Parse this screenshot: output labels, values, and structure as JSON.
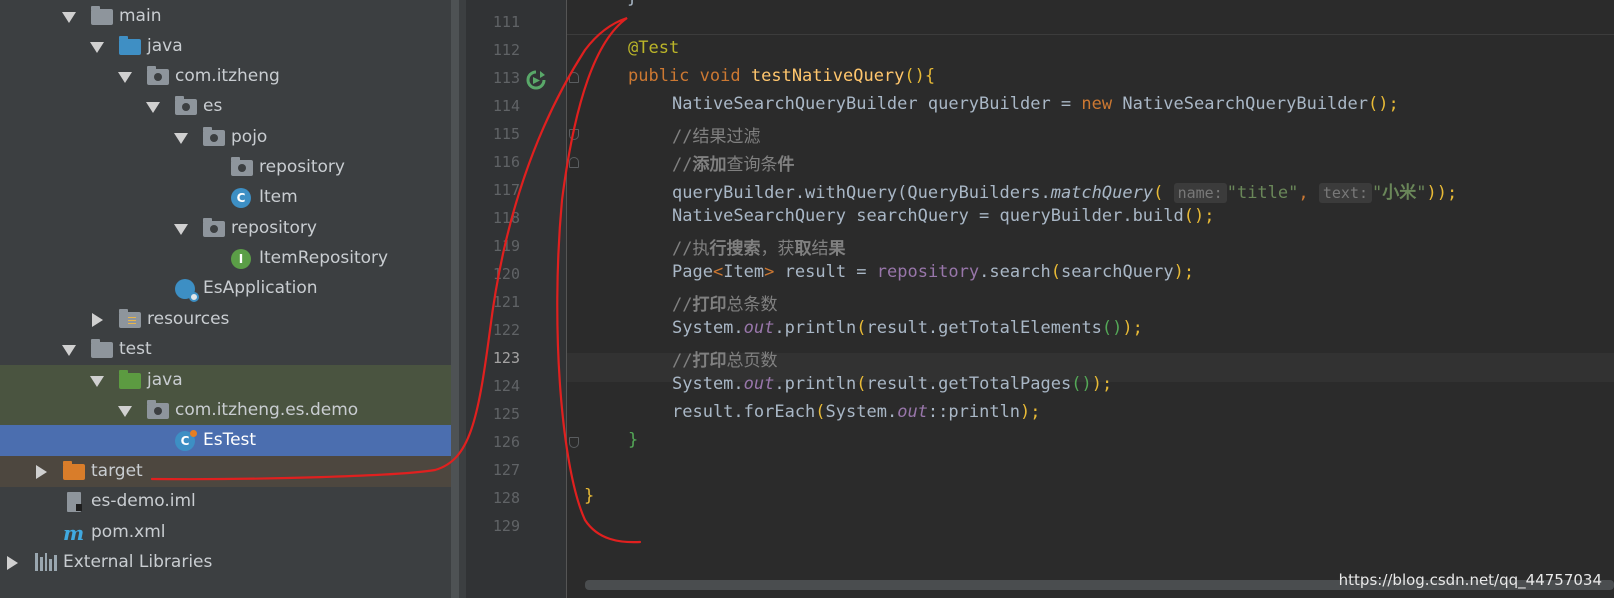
{
  "project_tree": {
    "items": [
      {
        "label": "main",
        "icon": "folder-icon",
        "expanded": true
      },
      {
        "label": "java",
        "icon": "source-folder-icon",
        "expanded": true
      },
      {
        "label": "com.itzheng",
        "icon": "package-icon",
        "expanded": true
      },
      {
        "label": "es",
        "icon": "package-icon",
        "expanded": true
      },
      {
        "label": "pojo",
        "icon": "package-icon",
        "expanded": true
      },
      {
        "label": "repository",
        "icon": "package-icon"
      },
      {
        "label": "Item",
        "icon": "class-icon",
        "icon_letter": "C"
      },
      {
        "label": "repository",
        "icon": "package-icon",
        "expanded": true
      },
      {
        "label": "ItemRepository",
        "icon": "interface-icon",
        "icon_letter": "I"
      },
      {
        "label": "EsApplication",
        "icon": "spring-boot-app-icon"
      },
      {
        "label": "resources",
        "icon": "resources-folder-icon",
        "expanded": false
      },
      {
        "label": "test",
        "icon": "folder-icon",
        "expanded": true
      },
      {
        "label": "java",
        "icon": "test-source-folder-icon",
        "expanded": true
      },
      {
        "label": "com.itzheng.es.demo",
        "icon": "package-icon",
        "expanded": true
      },
      {
        "label": "EsTest",
        "icon": "test-class-icon",
        "icon_letter": "C",
        "selected": true
      },
      {
        "label": "target",
        "icon": "excluded-folder-icon",
        "expanded": false
      },
      {
        "label": "es-demo.iml",
        "icon": "iml-file-icon"
      },
      {
        "label": "pom.xml",
        "icon": "maven-icon",
        "icon_letter": "m"
      },
      {
        "label": "External Libraries",
        "icon": "library-icon",
        "expanded": false
      }
    ]
  },
  "editor": {
    "line_numbers": [
      "111",
      "112",
      "113",
      "114",
      "115",
      "116",
      "117",
      "118",
      "119",
      "120",
      "121",
      "122",
      "123",
      "124",
      "125",
      "126",
      "127",
      "128",
      "129"
    ],
    "current_line": "123",
    "code": {
      "top_brace": "}",
      "annotation": "@Test",
      "l113": {
        "public": "public",
        "void": "void",
        "method": "testNativeQuery",
        "tail": "(){"
      },
      "l114": {
        "a": "NativeSearchQueryBuilder queryBuilder = ",
        "new": "new",
        "b": " NativeSearchQueryBuilder",
        "c": "();"
      },
      "l115": {
        "slashes": "//",
        "text": "结果过滤",
        "bold": "果"
      },
      "l116": {
        "slashes": "//",
        "bold1": "添加",
        "text": "查询条",
        "bold2": "件"
      },
      "l117": {
        "a": "queryBuilder.withQuery(QueryBuilders.",
        "method": "matchQuery",
        "open": "(",
        "hint1": "name:",
        "str1": "\"title\"",
        "comma": ",",
        "hint2": "text:",
        "str2a": "\"",
        "str2b": "小米",
        "str2c": "\"",
        "close": "));"
      },
      "l118": {
        "a": "NativeSearchQuery searchQuery = queryBuilder.build",
        "b": "();"
      },
      "l119": {
        "slashes": "//",
        "t1": "执",
        "b1": "行搜索",
        "t2": "，获",
        "b2": "取",
        "t3": "结",
        "b3": "果"
      },
      "l120": {
        "a": "Page",
        "lt": "<",
        "b": "Item",
        "gt": ">",
        "c": " result = ",
        "field": "repository",
        "d": ".search",
        "e": "(",
        "f": "searchQuery",
        "g": ");"
      },
      "l121": {
        "slashes": "//",
        "bold": "打印",
        "text": "总条数"
      },
      "l122": {
        "a": "System.",
        "out": "out",
        "b": ".println",
        "c": "(",
        "d": "result.getTotalElements",
        "e": "()",
        "f": ");"
      },
      "l123": {
        "slashes": "//",
        "bold": "打印",
        "text": "总页数"
      },
      "l124": {
        "a": "System.",
        "out": "out",
        "b": ".println",
        "c": "(",
        "d": "result.getTotalPages",
        "e": "()",
        "f": ");"
      },
      "l125": {
        "a": "result.forEach",
        "b": "(",
        "c": "System.",
        "out": "out",
        "d": "::println",
        "e": ");"
      },
      "close_method": "}",
      "close_class": "}"
    }
  },
  "watermark": "https://blog.csdn.net/qq_44757034",
  "colors": {
    "tree_bg": "#3c3f41",
    "editor_bg": "#2b2b2b",
    "selection": "#4b6eaf",
    "keyword": "#cc7832",
    "string": "#6a8759",
    "method_decl": "#ffc66d",
    "annotation": "#bbb529",
    "field": "#9876aa",
    "comment": "#808080",
    "hand_drawn_annotation": "#e0201f"
  }
}
